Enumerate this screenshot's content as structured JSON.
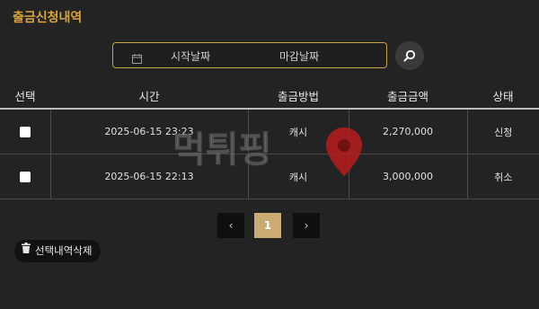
{
  "page": {
    "title": "출금신청내역"
  },
  "search": {
    "start_placeholder": "시작날짜",
    "end_placeholder": "마감날짜",
    "icon": "search-icon",
    "calendar_icon": "calendar-icon"
  },
  "table": {
    "headers": [
      "선택",
      "시간",
      "출금방법",
      "출금금액",
      "상태"
    ],
    "rows": [
      {
        "time": "2025-06-15 23:23",
        "method": "캐시",
        "amount": "2,270,000",
        "status": "신청",
        "status_color": "#d6d6d6"
      },
      {
        "time": "2025-06-15 22:13",
        "method": "캐시",
        "amount": "3,000,000",
        "status": "취소",
        "status_color": "#e0423c"
      }
    ]
  },
  "pagination": {
    "prev": "‹",
    "current": "1",
    "next": "›"
  },
  "actions": {
    "delete_selected": "선택내역삭제",
    "delete_icon": "trash-icon"
  },
  "watermark": {
    "text": "먹튀핑"
  },
  "colors": {
    "accent_gold": "#d9a43a",
    "page_active": "#c9ab73",
    "cancelled_red": "#e0423c",
    "background": "#232323"
  }
}
